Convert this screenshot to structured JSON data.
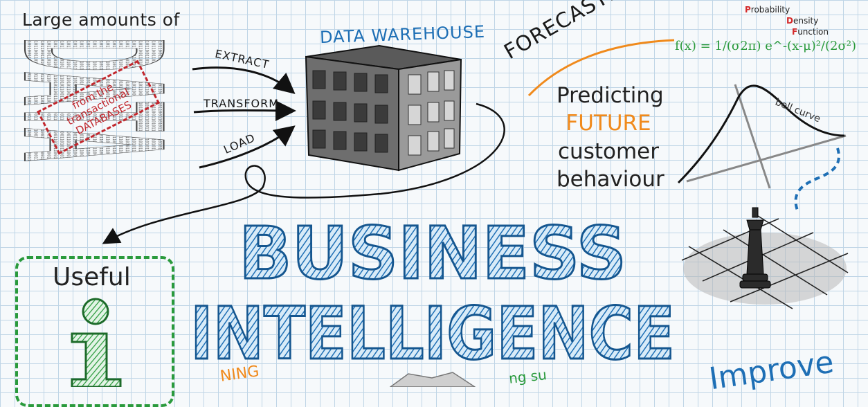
{
  "header": {
    "large_amounts": "Large amounts of",
    "data_word": "DATA",
    "stamp": "from the transactional DATABASES"
  },
  "etl": {
    "extract": "EXTRACT",
    "transform": "TRANSFORM",
    "load": "LOAD"
  },
  "warehouse": {
    "title": "DATA WAREHOUSE"
  },
  "forecasting": {
    "title": "FORECASTING",
    "predicting": "Predicting",
    "future": "FUTURE",
    "customer": "customer",
    "behaviour": "behaviour"
  },
  "pdf": {
    "p": "P",
    "robability": "robability",
    "d": "D",
    "ensity": "ensity",
    "f": "F",
    "unction": "unction",
    "formula": "f(x) = 1/(σ2π) e^-(x-μ)²/(2σ²)"
  },
  "bell": {
    "label": "bell curve"
  },
  "useful": {
    "label": "Useful",
    "icon_letter": "i"
  },
  "main_title": {
    "line1": "BUSINESS",
    "line2": "INTELLIGENCE"
  },
  "improve": {
    "label": "Improve"
  },
  "partial": {
    "left": "NING",
    "middle": "ng su"
  },
  "colors": {
    "blue": "#1e6fb5",
    "orange": "#f08a1c",
    "green": "#2a9a3c",
    "red": "#c1272d",
    "grid": "#bfd5e6"
  }
}
